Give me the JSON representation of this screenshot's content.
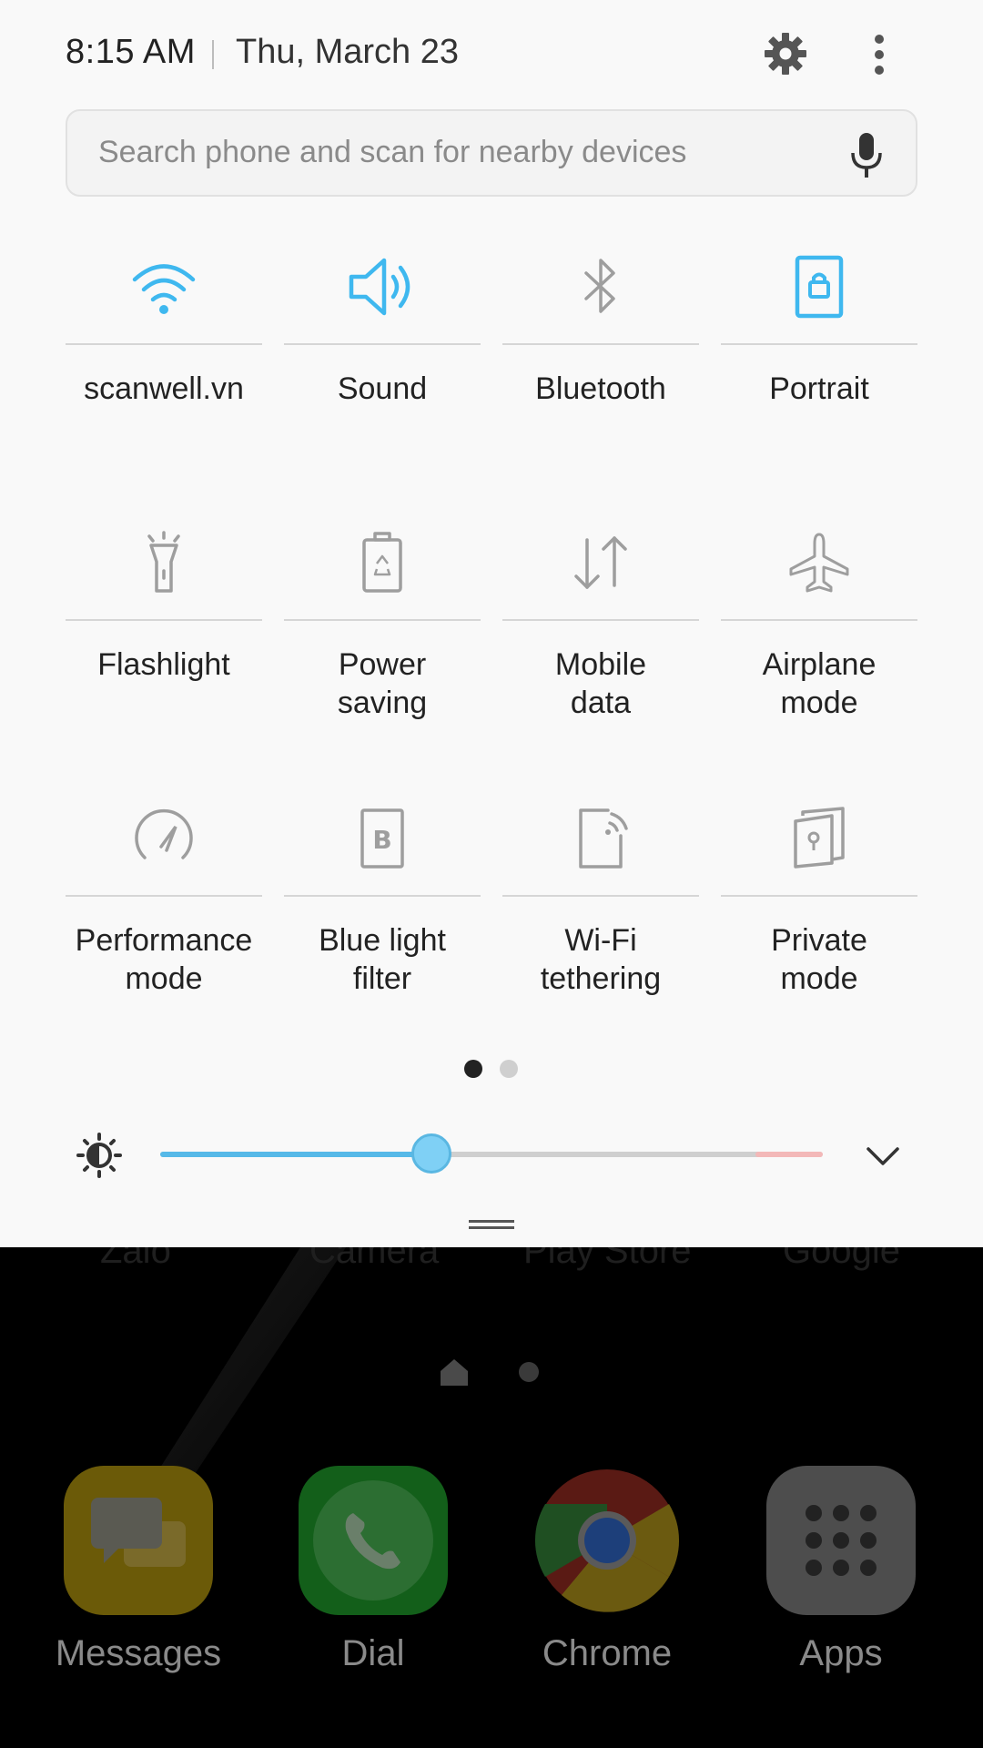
{
  "status": {
    "time": "8:15 AM",
    "date": "Thu, March 23"
  },
  "search": {
    "placeholder": "Search phone and scan for nearby devices"
  },
  "tiles": [
    {
      "label": "scanwell.vn",
      "icon": "wifi-icon",
      "active": true
    },
    {
      "label": "Sound",
      "icon": "speaker-icon",
      "active": true
    },
    {
      "label": "Bluetooth",
      "icon": "bluetooth-icon",
      "active": false
    },
    {
      "label": "Portrait",
      "icon": "portrait-lock-icon",
      "active": true
    },
    {
      "label": "Flashlight",
      "icon": "flashlight-icon",
      "active": false
    },
    {
      "label": "Power\nsaving",
      "icon": "power-saving-icon",
      "active": false
    },
    {
      "label": "Mobile\ndata",
      "icon": "mobile-data-icon",
      "active": false
    },
    {
      "label": "Airplane\nmode",
      "icon": "airplane-icon",
      "active": false
    },
    {
      "label": "Performance\nmode",
      "icon": "performance-icon",
      "active": false
    },
    {
      "label": "Blue light\nfilter",
      "icon": "blue-light-filter-icon",
      "active": false
    },
    {
      "label": "Wi-Fi\ntethering",
      "icon": "wifi-tethering-icon",
      "active": false
    },
    {
      "label": "Private\nmode",
      "icon": "private-mode-icon",
      "active": false
    }
  ],
  "pager": {
    "pages": 2,
    "current": 1
  },
  "brightness": {
    "level": 0.41
  },
  "colors": {
    "accent": "#3fb8ef",
    "inactive_icon": "#9e9e9e",
    "panel_bg": "#f9f9f9"
  },
  "home": {
    "ghost_labels": [
      "Zalo",
      "Camera",
      "Play Store",
      "Google"
    ],
    "dock": [
      {
        "label": "Messages",
        "icon": "messages-icon"
      },
      {
        "label": "Dial",
        "icon": "phone-icon"
      },
      {
        "label": "Chrome",
        "icon": "chrome-icon"
      },
      {
        "label": "Apps",
        "icon": "apps-grid-icon"
      }
    ]
  }
}
